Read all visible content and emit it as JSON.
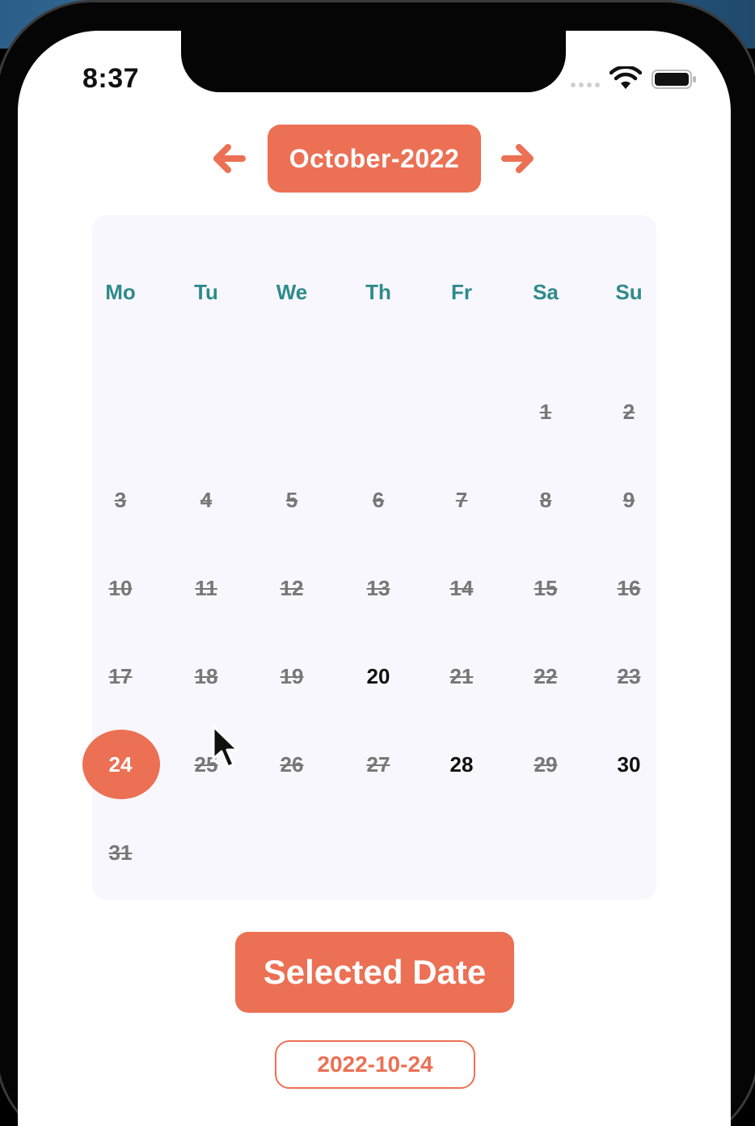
{
  "status_bar": {
    "time": "8:37"
  },
  "month_nav": {
    "title": "October-2022",
    "prev_icon": "arrow-left-icon",
    "next_icon": "arrow-right-icon"
  },
  "colors": {
    "accent": "#ec7054",
    "weekday": "#2e8b8b",
    "calendar_bg": "#f8f7fd"
  },
  "calendar": {
    "weekdays": [
      "Mo",
      "Tu",
      "We",
      "Th",
      "Fr",
      "Sa",
      "Su"
    ],
    "first_day_column": 5,
    "days": [
      {
        "d": "1",
        "s": "disabled"
      },
      {
        "d": "2",
        "s": "disabled"
      },
      {
        "d": "3",
        "s": "disabled"
      },
      {
        "d": "4",
        "s": "disabled"
      },
      {
        "d": "5",
        "s": "disabled"
      },
      {
        "d": "6",
        "s": "disabled"
      },
      {
        "d": "7",
        "s": "disabled"
      },
      {
        "d": "8",
        "s": "disabled"
      },
      {
        "d": "9",
        "s": "disabled"
      },
      {
        "d": "10",
        "s": "disabled"
      },
      {
        "d": "11",
        "s": "disabled"
      },
      {
        "d": "12",
        "s": "disabled"
      },
      {
        "d": "13",
        "s": "disabled"
      },
      {
        "d": "14",
        "s": "disabled"
      },
      {
        "d": "15",
        "s": "disabled"
      },
      {
        "d": "16",
        "s": "disabled"
      },
      {
        "d": "17",
        "s": "disabled"
      },
      {
        "d": "18",
        "s": "disabled"
      },
      {
        "d": "19",
        "s": "disabled"
      },
      {
        "d": "20",
        "s": "enabled"
      },
      {
        "d": "21",
        "s": "disabled"
      },
      {
        "d": "22",
        "s": "disabled"
      },
      {
        "d": "23",
        "s": "disabled"
      },
      {
        "d": "24",
        "s": "selected"
      },
      {
        "d": "25",
        "s": "disabled"
      },
      {
        "d": "26",
        "s": "disabled"
      },
      {
        "d": "27",
        "s": "disabled"
      },
      {
        "d": "28",
        "s": "enabled"
      },
      {
        "d": "29",
        "s": "disabled"
      },
      {
        "d": "30",
        "s": "enabled"
      },
      {
        "d": "31",
        "s": "disabled"
      }
    ]
  },
  "selected_button": {
    "label": "Selected Date"
  },
  "selected_value": "2022-10-24"
}
